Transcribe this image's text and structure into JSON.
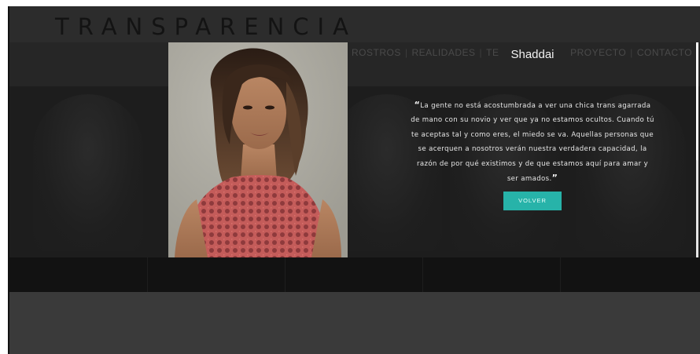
{
  "site": {
    "logo": "TRANSPARENCIA"
  },
  "nav": {
    "items": [
      "ROSTROS",
      "REALIDADES",
      "TE",
      "PROYECTO",
      "CONTACTO"
    ],
    "separator": "|"
  },
  "modal": {
    "name": "Shaddai",
    "quote_open": "“",
    "quote_text": "La gente no está acostumbrada a ver una chica trans agarrada de mano con su novio y ver que ya no estamos ocultos. Cuando tú te aceptas tal y como eres, el miedo se va. Aquellas personas que se acerquen a nosotros verán nuestra verdadera capacidad, la razón de por qué existimos y de que estamos aquí para amar y ser amados.",
    "quote_close": "”",
    "button_label": "VOLVER",
    "photo_icon": "portrait-photo"
  },
  "colors": {
    "accent": "#27b3a9",
    "page_background": "#3c3c3c",
    "overlay": "#1d1d1d"
  }
}
